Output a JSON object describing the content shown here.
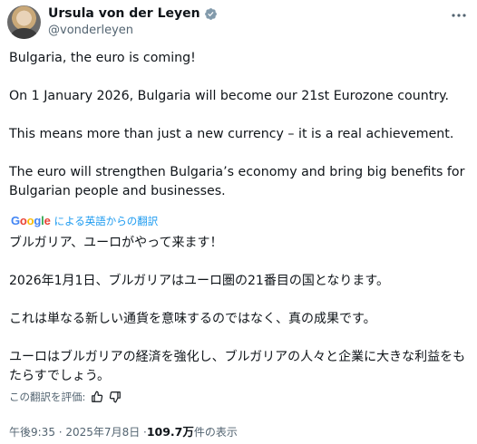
{
  "author": {
    "name": "Ursula von der Leyen",
    "handle": "@vonderleyen",
    "verified_icon": "verified-badge-icon"
  },
  "tweet": {
    "lines": [
      "Bulgaria, the euro is coming!",
      "On 1 January 2026, Bulgaria will become our 21st Eurozone country.",
      "This means more than just a new currency – it is a real achievement.",
      "The euro will strengthen Bulgaria’s economy and bring big benefits for Bulgarian people and businesses."
    ]
  },
  "translation": {
    "provider": "Google",
    "label": "による英語からの翻訳",
    "lines": [
      "ブルガリア、ユーロがやって来ます！",
      "2026年1月1日、ブルガリアはユーロ圏の21番目の国となります。",
      "これは単なる新しい通貨を意味するのではなく、真の成果です。",
      "ユーロはブルガリアの経済を強化し、ブルガリアの人々と企業に大きな利益をもたらすでしょう。"
    ],
    "rate_label": "この翻訳を評価:"
  },
  "meta": {
    "time": "午後9:35 · 2025年7月8日 · ",
    "views": "109.7万",
    "views_suffix": " 件の表示"
  },
  "colors": {
    "text": "#0f1419",
    "secondary": "#536471",
    "link": "#1d9bf0",
    "verified": "#829aab"
  }
}
